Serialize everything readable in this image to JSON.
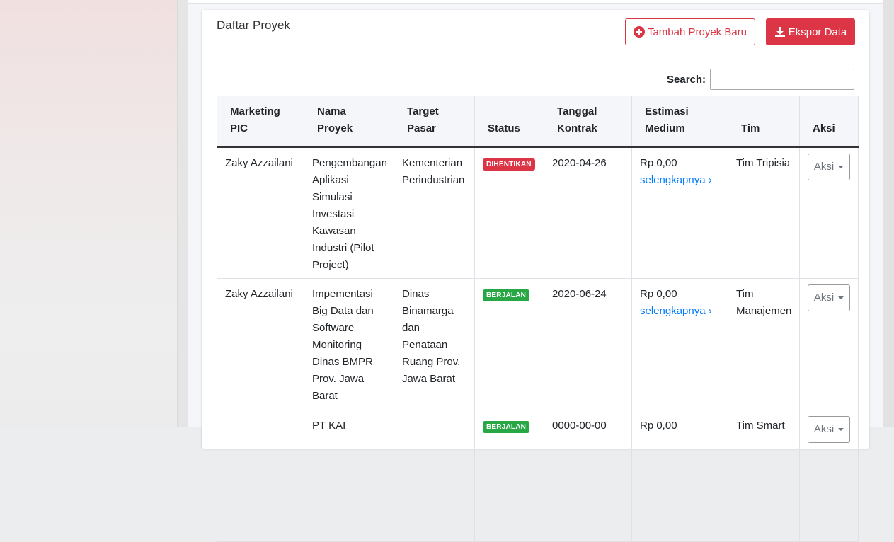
{
  "card": {
    "title": "Daftar Proyek",
    "add_button": "Tambah Proyek Baru",
    "export_button": "Ekspor Data"
  },
  "search": {
    "label": "Search:",
    "value": ""
  },
  "table": {
    "headers": [
      "Marketing PIC",
      "Nama Proyek",
      "Target Pasar",
      "Status",
      "Tanggal Kontrak",
      "Estimasi Medium",
      "Tim",
      "Aksi"
    ],
    "rows": [
      {
        "pic": "Zaky Azzailani",
        "nama": "Pengembangan Aplikasi Simulasi Investasi Kawasan Industri (Pilot Project)",
        "target": "Kementerian Perindustrian",
        "status": "DIHENTIKAN",
        "tanggal": "2020-04-26",
        "estimasi": "Rp 0,00",
        "more_link": "selengkapnya ›",
        "tim": "Tim Tripisia",
        "aksi": "Aksi"
      },
      {
        "pic": "Zaky Azzailani",
        "nama": "Impementasi Big Data dan Software Monitoring Dinas BMPR Prov. Jawa Barat",
        "target": "Dinas Binamarga dan Penataan Ruang Prov. Jawa Barat",
        "status": "BERJALAN",
        "tanggal": "2020-06-24",
        "estimasi": "Rp 0,00",
        "more_link": "selengkapnya ›",
        "tim": "Tim Manajemen",
        "aksi": "Aksi"
      },
      {
        "pic": "",
        "nama": "PT KAI",
        "target": "",
        "status": "BERJALAN",
        "tanggal": "0000-00-00",
        "estimasi": "Rp 0,00",
        "more_link": "",
        "tim": "Tim Smart",
        "aksi": "Aksi"
      }
    ]
  },
  "colors": {
    "danger": "#dc3545",
    "success": "#28a745",
    "link": "#007bff"
  },
  "icons": {
    "add": "plus-circle-icon",
    "export": "download-icon",
    "dropdown": "caret-down-icon"
  }
}
